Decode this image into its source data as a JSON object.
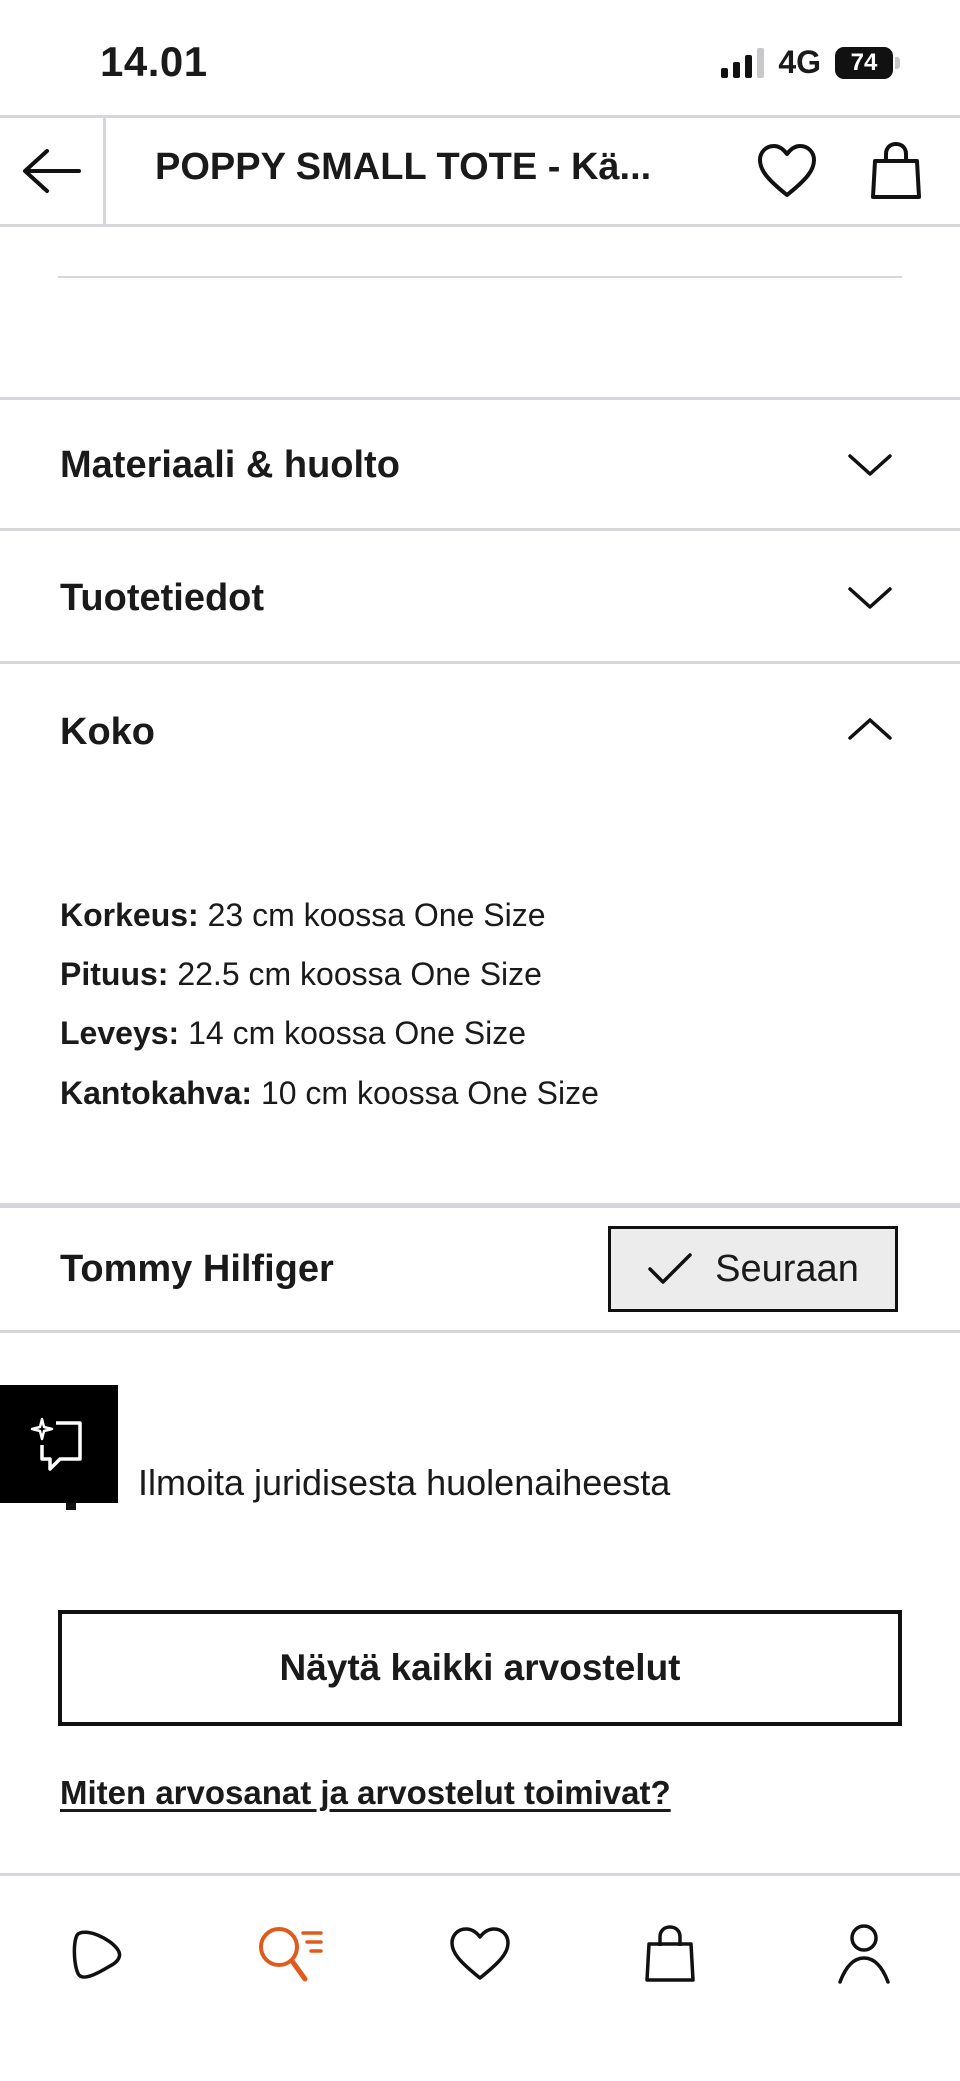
{
  "status_bar": {
    "time": "14.01",
    "network": "4G",
    "battery": "74"
  },
  "header": {
    "title": "POPPY SMALL TOTE - Kä...",
    "back_icon": "arrow-left-icon",
    "wishlist_icon": "heart-icon",
    "cart_icon": "shopping-bag-icon"
  },
  "accordion": {
    "material": {
      "label": "Materiaali & huolto",
      "state": "collapsed"
    },
    "product_info": {
      "label": "Tuotetiedot",
      "state": "collapsed"
    },
    "size": {
      "label": "Koko",
      "state": "expanded"
    }
  },
  "size_details": [
    {
      "label": "Korkeus:",
      "value": " 23 cm koossa One Size"
    },
    {
      "label": "Pituus:",
      "value": " 22.5 cm koossa One Size"
    },
    {
      "label": "Leveys:",
      "value": " 14 cm koossa One Size"
    },
    {
      "label": "Kantokahva:",
      "value": " 10 cm koossa One Size"
    }
  ],
  "brand": {
    "name": "Tommy Hilfiger",
    "follow_label": "Seuraan"
  },
  "report": {
    "text": "Ilmoita juridisesta huolenaiheesta"
  },
  "reviews": {
    "button_label": "Näytä kaikki arvostelut",
    "help_link": "Miten arvosanat ja arvostelut toimivat?"
  },
  "bottom_nav": {
    "items": [
      "home-play-icon",
      "search-icon",
      "heart-icon",
      "shopping-bag-icon",
      "profile-icon"
    ],
    "active": "search-icon",
    "accent": "#e05a1c"
  }
}
